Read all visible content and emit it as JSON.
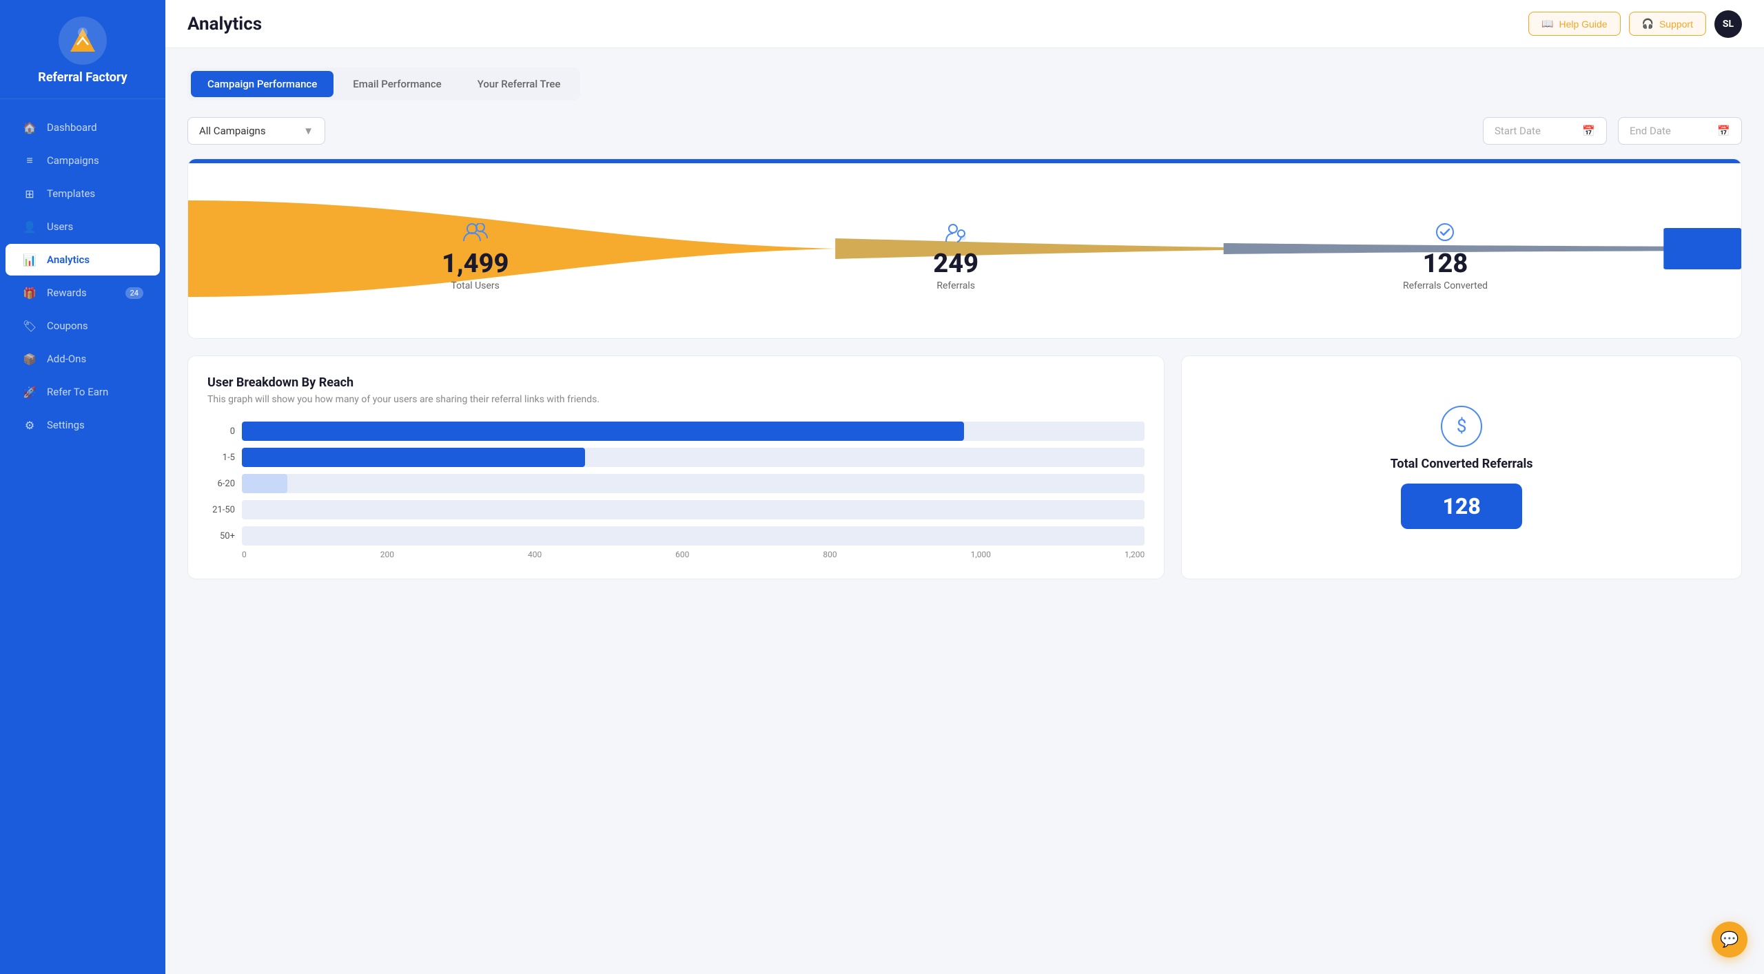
{
  "sidebar": {
    "logo_title": "Referral Factory",
    "nav_items": [
      {
        "id": "dashboard",
        "label": "Dashboard",
        "icon": "🏠",
        "badge": null,
        "active": false
      },
      {
        "id": "campaigns",
        "label": "Campaigns",
        "icon": "≡",
        "badge": null,
        "active": false
      },
      {
        "id": "templates",
        "label": "Templates",
        "icon": "⊞",
        "badge": null,
        "active": false
      },
      {
        "id": "users",
        "label": "Users",
        "icon": "👤",
        "badge": null,
        "active": false
      },
      {
        "id": "analytics",
        "label": "Analytics",
        "icon": "📊",
        "badge": null,
        "active": true
      },
      {
        "id": "rewards",
        "label": "Rewards",
        "icon": "🎁",
        "badge": "24",
        "active": false
      },
      {
        "id": "coupons",
        "label": "Coupons",
        "icon": "🏷",
        "badge": null,
        "active": false
      },
      {
        "id": "addons",
        "label": "Add-Ons",
        "icon": "📦",
        "badge": null,
        "active": false
      },
      {
        "id": "refer-to-earn",
        "label": "Refer To Earn",
        "icon": "🚀",
        "badge": null,
        "active": false
      },
      {
        "id": "settings",
        "label": "Settings",
        "icon": "⚙",
        "badge": null,
        "active": false
      }
    ]
  },
  "topbar": {
    "page_title": "Analytics",
    "help_label": "Help Guide",
    "support_label": "Support",
    "avatar_initials": "SL"
  },
  "tabs": [
    {
      "id": "campaign-performance",
      "label": "Campaign Performance",
      "active": true
    },
    {
      "id": "email-performance",
      "label": "Email Performance",
      "active": false
    },
    {
      "id": "your-referral-tree",
      "label": "Your Referral Tree",
      "active": false
    }
  ],
  "filters": {
    "campaign_select_label": "All Campaigns",
    "start_date_placeholder": "Start Date",
    "end_date_placeholder": "End Date"
  },
  "funnel": {
    "stats": [
      {
        "id": "total-users",
        "number": "1,499",
        "label": "Total Users"
      },
      {
        "id": "referrals",
        "number": "249",
        "label": "Referrals"
      },
      {
        "id": "referrals-converted",
        "number": "128",
        "label": "Referrals Converted"
      }
    ]
  },
  "breakdown": {
    "title": "User Breakdown By Reach",
    "description": "This graph will show you how many of your users are sharing their referral links with friends.",
    "bars": [
      {
        "label": "0",
        "width_percent": 80,
        "light": false
      },
      {
        "label": "1-5",
        "width_percent": 38,
        "light": false
      },
      {
        "label": "6-20",
        "width_percent": 5,
        "light": true
      },
      {
        "label": "21-50",
        "width_percent": 0,
        "light": true
      },
      {
        "label": "50+",
        "width_percent": 0,
        "light": true
      }
    ],
    "x_axis": [
      "0",
      "200",
      "400",
      "600",
      "800",
      "1,000",
      "1,200"
    ]
  },
  "converted_referrals": {
    "title": "Total Converted Referrals",
    "value": "128"
  }
}
